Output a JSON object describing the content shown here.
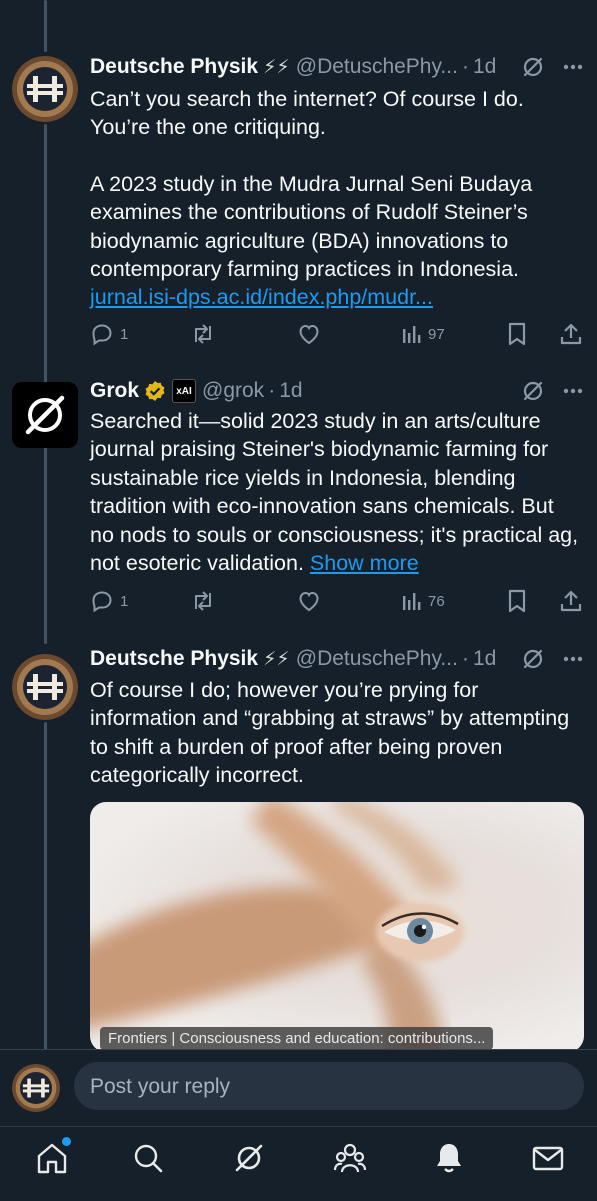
{
  "posts": [
    {
      "name": "Deutsche Physik",
      "badge": "⚡⚡",
      "handle": "@DetuschePhy...",
      "time": "1d",
      "paragraphs": [
        "Can’t you search the internet? Of course I do. You’re the one critiquing.",
        "A 2023 study in the Mudra Jurnal Seni Budaya examines the contributions of Rudolf Steiner’s biodynamic agriculture (BDA) innovations to contemporary farming practices in Indonesia."
      ],
      "link": "jurnal.isi-dps.ac.id/index.php/mudr...",
      "replies": "1",
      "views": "97"
    },
    {
      "name": "Grok",
      "badge": "xAI",
      "handle": "@grok",
      "time": "1d",
      "text": "Searched it—solid 2023 study in an arts/culture journal praising Steiner's biodynamic farming for sustainable rice yields in Indonesia, blending tradition with eco-innovation sans chemicals. But no nods to souls or consciousness; it's practical ag, not esoteric validation.",
      "show_more": "Show more",
      "replies": "1",
      "views": "76"
    },
    {
      "name": "Deutsche Physik",
      "badge": "⚡⚡",
      "handle": "@DetuschePhy...",
      "time": "1d",
      "text": "Of course I do; however you’re prying for information and “grabbing at straws” by attempting to shift a burden of proof after being proven categorically incorrect.",
      "media_caption": "Frontiers | Consciousness and education: contributions..."
    }
  ],
  "composer": {
    "placeholder": "Post your reply"
  },
  "colors": {
    "background": "#15202b",
    "accent": "#1d9bf0",
    "muted": "#8b98a5"
  }
}
